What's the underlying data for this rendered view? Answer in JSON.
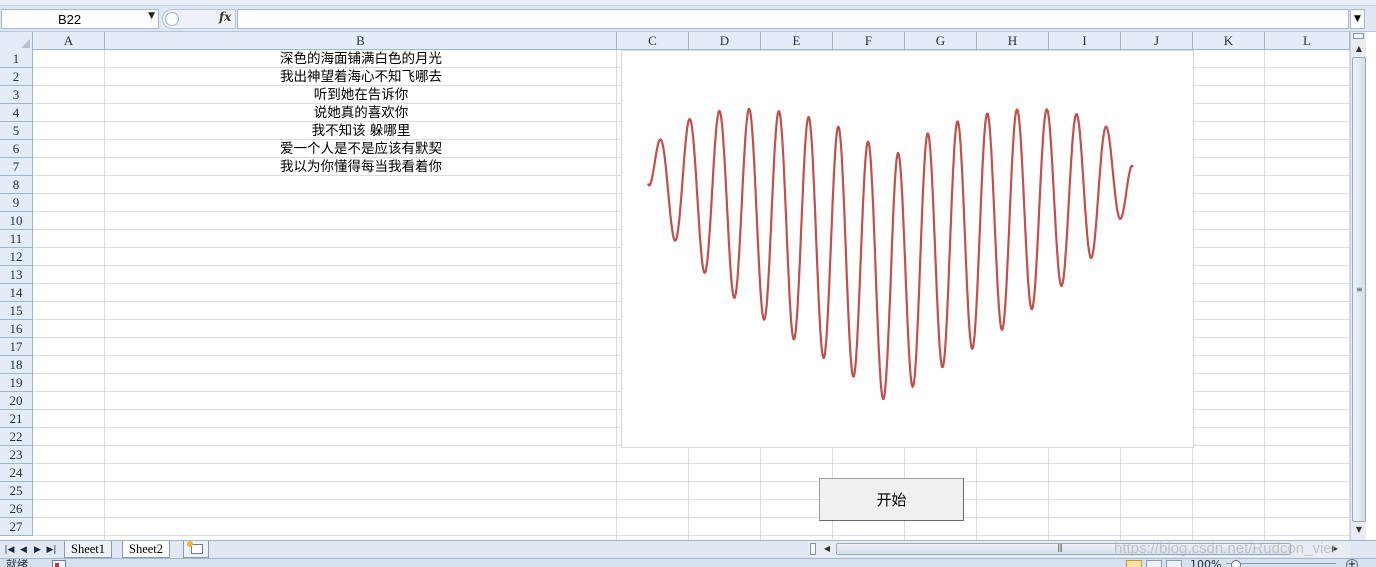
{
  "formula_bar": {
    "name_box": "B22",
    "fx_label": "fx",
    "formula": ""
  },
  "columns": [
    "A",
    "B",
    "C",
    "D",
    "E",
    "F",
    "G",
    "H",
    "I",
    "J",
    "K",
    "L"
  ],
  "rows": [
    "1",
    "2",
    "3",
    "4",
    "5",
    "6",
    "7",
    "8",
    "9",
    "10",
    "11",
    "12",
    "13",
    "14",
    "15",
    "16",
    "17",
    "18",
    "19",
    "20",
    "21",
    "22",
    "23",
    "24",
    "25",
    "26",
    "27"
  ],
  "cells_b": [
    "深色的海面铺满白色的月光",
    "我出神望着海心不知飞哪去",
    "听到她在告诉你",
    "说她真的喜欢你",
    "我不知该  躲哪里",
    "爱一个人是不是应该有默契",
    "我以为你懂得每当我看着你"
  ],
  "chart_data": {
    "type": "line",
    "xlabel": "",
    "ylabel": "",
    "grid": false,
    "legend": "none",
    "color": "#c0504d",
    "series": [
      {
        "x": [],
        "values": []
      }
    ]
  },
  "start_button": {
    "label": "开始"
  },
  "sheets": [
    {
      "label": "Sheet1",
      "active": false
    },
    {
      "label": "Sheet2",
      "active": true
    }
  ],
  "watermark": "https://blog.csdn.net/Rudcon_vier",
  "status": {
    "ready": "就绪",
    "zoom": "100%"
  },
  "icons": {
    "name_box_dropdown": "chevron-down-icon",
    "fx": "function-icon",
    "insert_sheet": "insert-sheet-icon",
    "macro": "macro-record-icon"
  }
}
